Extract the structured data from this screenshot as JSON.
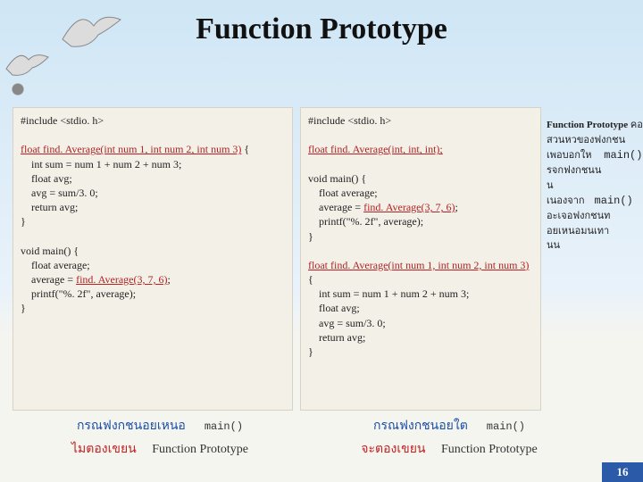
{
  "title": "Function Prototype",
  "left_code": {
    "line1": "#include <stdio. h>",
    "sig": "float find. Average(int num 1, int num 2, int num 3)",
    "body1": "    int sum = num 1 + num 2 + num 3;",
    "body2": "    float avg;",
    "body3": "    avg = sum/3. 0;",
    "body4": "    return avg;",
    "body5": "}",
    "main1": "void main() {",
    "main2": "    float average;",
    "main3_pre": "    average = ",
    "main3_call": "find. Average(3, 7, 6)",
    "main3_post": ";",
    "main4": "    printf(\"%. 2f\", average);",
    "main5": "}"
  },
  "right_code": {
    "line1": "#include <stdio. h>",
    "proto": "float find. Average(int, int, int);",
    "main1": "void main() {",
    "main2": "    float average;",
    "main3_pre": "    average = ",
    "main3_call": "find. Average(3, 7, 6)",
    "main3_post": ";",
    "main4": "    printf(\"%. 2f\", average);",
    "main5": "}",
    "sig": "float find. Average(int num 1, int num 2, int num 3)",
    "body1": "    int sum = num 1 + num 2 + num 3;",
    "body2": "    float avg;",
    "body3": "    avg = sum/3. 0;",
    "body4": "    return avg;",
    "body5": "}"
  },
  "callout": {
    "fp": "Function Prototype",
    "t1": " คอ",
    "t2": "สวนหวของฟงกชน",
    "t3": "เพอบอกให",
    "t4": "รจกฟงกชนน",
    "t5": "น",
    "t6": "เนองจาก",
    "t7": "อะเจอฟงกชนท",
    "t8": "อยเหนอมนเทา",
    "t9": "นน",
    "main_token": "main()"
  },
  "caption": {
    "left1_a": "กรณฟงกชนอยเหนอ",
    "left1_b": "main()",
    "left2_a": "ไมตองเขยน",
    "left2_b": "Function Prototype",
    "right1_a": "กรณฟงกชนอยใต",
    "right1_b": "main()",
    "right2_a": "จะตองเขยน",
    "right2_b": "Function Prototype"
  },
  "page": "16"
}
